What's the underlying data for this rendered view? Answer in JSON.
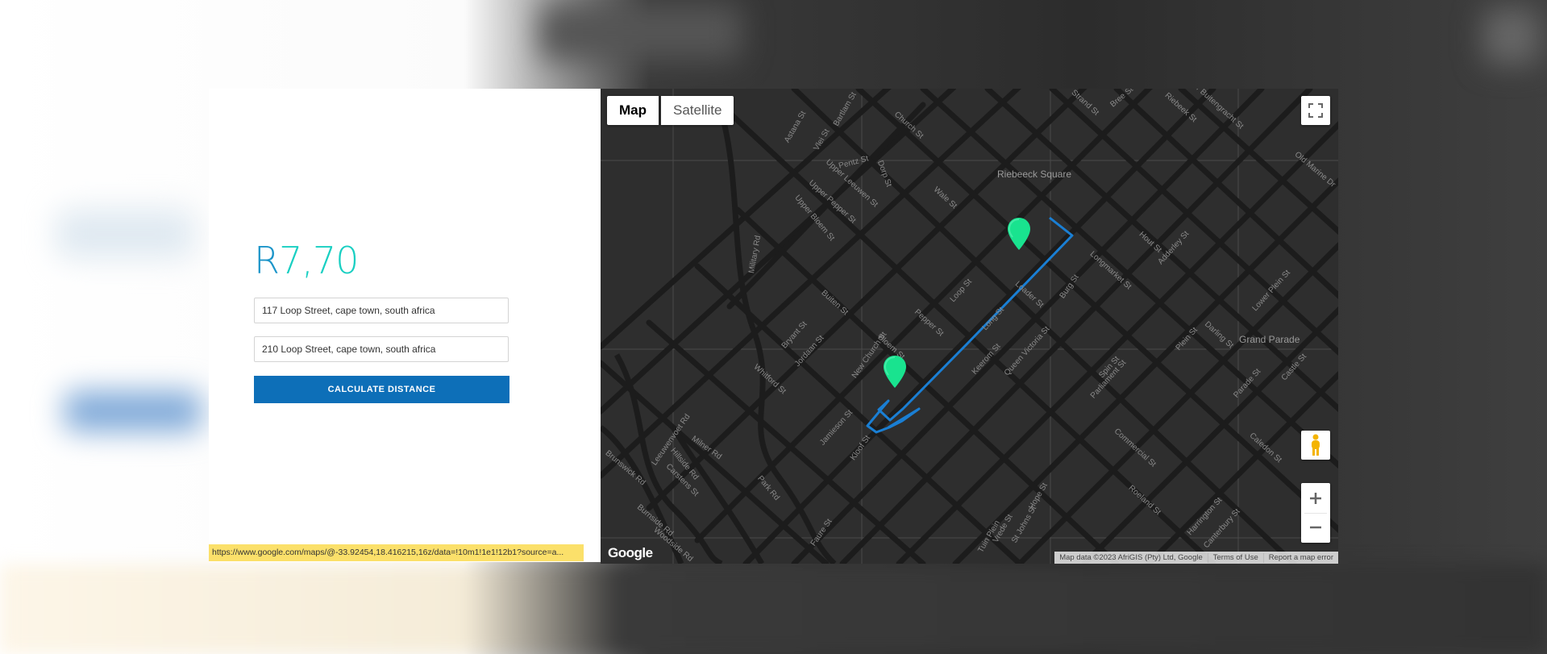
{
  "calculator": {
    "price_currency": "R",
    "price_amount": "7,70",
    "origin_value": "117 Loop Street, cape town, south africa",
    "destination_value": "210 Loop Street, cape town, south africa",
    "calculate_label": "CALCULATE DISTANCE",
    "colors": {
      "currency": "#1c95c9",
      "amount": "#19cfc2",
      "button": "#0d6fb8"
    }
  },
  "status_bar": {
    "url": "https://www.google.com/maps/@-33.92454,18.416215,16z/data=!10m1!1e1!12b1?source=a..."
  },
  "map": {
    "type_controls": [
      "Map",
      "Satellite"
    ],
    "active_type": "Map",
    "logo_text": "Google",
    "attribution": {
      "data": "Map data ©2023 AfriGIS (Pty) Ltd, Google",
      "terms": "Terms of Use",
      "report": "Report a map error"
    },
    "place_labels": [
      "Riebeeck Square",
      "Grand Parade"
    ],
    "street_labels": [
      "Strand St",
      "Bree St",
      "Riebeek St",
      "Church St",
      "Pentz St",
      "Astana St",
      "Vlei St",
      "Bartlam St",
      "Upper Leeuwen St",
      "Upper Pepper St",
      "Upper Bloem St",
      "Dorp St",
      "Wale St",
      "Loader St",
      "Long St",
      "Burg St",
      "Hout St",
      "Adderley St",
      "Longmarket St",
      "Lower Plein St",
      "Darling St",
      "Plein St",
      "Parade St",
      "Castle St",
      "Military Rd",
      "Bryant St",
      "Jordaan St",
      "Buiten St",
      "Bloem St",
      "New Church St",
      "Pepper St",
      "Loop St",
      "Keerom St",
      "Queen Victoria St",
      "Spin St",
      "Parliament St",
      "Commercial St",
      "Roeland St",
      "Harrington St",
      "Canterbury St",
      "Caledon St",
      "Hope St",
      "Vrede St",
      "Kloof St",
      "Jamieson St",
      "Whitford St",
      "Leeuwenvoet Rd",
      "Hillside Rd",
      "Milner Rd",
      "Carstens St",
      "Brunswick Rd",
      "Burnside Rd",
      "Faure St",
      "Park Rd",
      "Woodside Rd",
      "St Johns St",
      "Tuin Plein",
      "Old Marine Dr",
      "Upper Buitengracht St"
    ],
    "route_color": "#1a7fd4",
    "marker_color": "#19e38f"
  }
}
